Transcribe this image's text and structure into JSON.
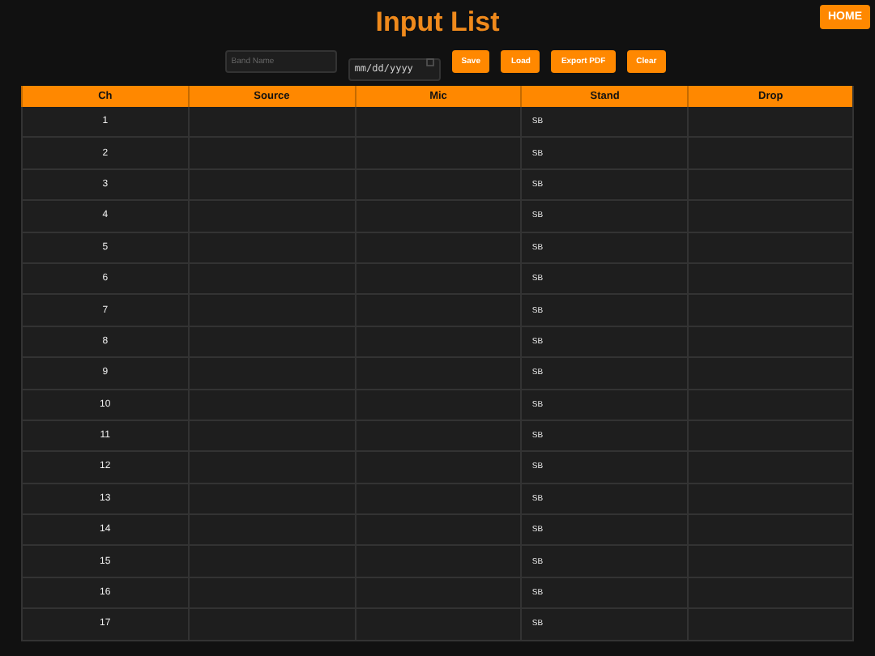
{
  "header": {
    "title": "Input List",
    "home_button": "HOME"
  },
  "controls": {
    "band_name": {
      "placeholder": "Band Name"
    },
    "date": {
      "placeholder": "mm/dd/yyyy"
    },
    "buttons": [
      "Save",
      "Load",
      "Export PDF",
      "Clear"
    ]
  },
  "table": {
    "columns": [
      "Ch",
      "Source",
      "Mic",
      "Stand",
      "Drop"
    ],
    "rows": [
      {
        "ch": "1",
        "stand": "SB"
      },
      {
        "ch": "2",
        "stand": "SB"
      },
      {
        "ch": "3",
        "stand": "SB"
      },
      {
        "ch": "4",
        "stand": "SB"
      },
      {
        "ch": "5",
        "stand": "SB"
      },
      {
        "ch": "6",
        "stand": "SB"
      },
      {
        "ch": "7",
        "stand": "SB"
      },
      {
        "ch": "8",
        "stand": "SB"
      },
      {
        "ch": "9",
        "stand": "SB"
      },
      {
        "ch": "10",
        "stand": "SB"
      },
      {
        "ch": "11",
        "stand": "SB"
      },
      {
        "ch": "12",
        "stand": "SB"
      },
      {
        "ch": "13",
        "stand": "SB"
      },
      {
        "ch": "14",
        "stand": "SB"
      },
      {
        "ch": "15",
        "stand": "SB"
      },
      {
        "ch": "16",
        "stand": "SB"
      },
      {
        "ch": "17",
        "stand": "SB"
      }
    ]
  }
}
